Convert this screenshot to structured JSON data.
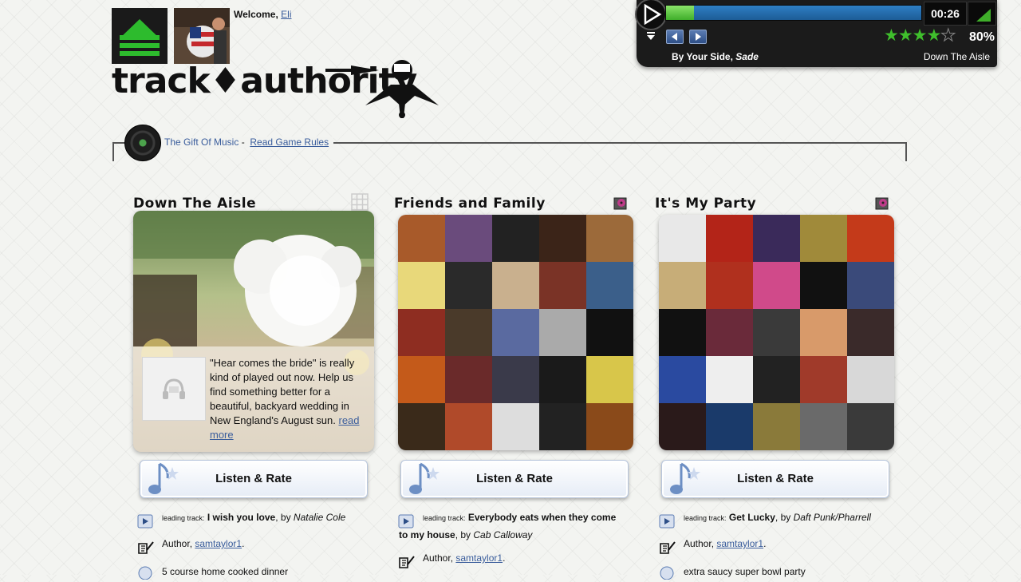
{
  "header": {
    "welcome_label": "Welcome,",
    "user_name": "Eli",
    "brand_logo_text": "track♦authority"
  },
  "player": {
    "time": "00:26",
    "progress_fraction": 0.11,
    "rating_stars": 4,
    "rating_max": 5,
    "rating_pct": "80%",
    "track_title": "By Your Side,",
    "track_artist": "Sade",
    "playlist_name": "Down The Aisle"
  },
  "game": {
    "title": "The Gift Of Music",
    "separator": "-",
    "rules_link": "Read Game Rules"
  },
  "cards": [
    {
      "title": "Down The Aisle",
      "description": "\"Hear comes the bride\" is really kind of played out now. Help us find something better for a beautiful, backyard wedding in New England's August sun.",
      "read_more": "read more",
      "listen_label": "Listen & Rate",
      "leading_label": "leading track:",
      "leading_track": "I wish you love",
      "by": ", by",
      "leading_artist": "Natalie Cole",
      "author_label": "Author,",
      "author": "samtaylor1",
      "dot": ".",
      "extra": "5 course home cooked dinner"
    },
    {
      "title": "Friends and Family",
      "listen_label": "Listen & Rate",
      "leading_label": "leading track:",
      "leading_track": "Everybody eats when they come to my house",
      "by": ", by",
      "leading_artist": "Cab Calloway",
      "author_label": "Author,",
      "author": "samtaylor1",
      "dot": ".",
      "album_grid_colors": [
        "#a85a2a",
        "#6a4b7c",
        "#222",
        "#3b2418",
        "#9c6a3a",
        "#e8d87a",
        "#2a2a2a",
        "#c9b08e",
        "#7a3326",
        "#3b5f8a",
        "#8e2d21",
        "#4a3a2a",
        "#5a6aa0",
        "#aaa",
        "#111",
        "#c45a1a",
        "#6a2a2a",
        "#3a3a4a",
        "#1a1a1a",
        "#d8c64a",
        "#3a2a1a",
        "#b04a2a",
        "#ddd",
        "#222",
        "#8a4a1a"
      ]
    },
    {
      "title": "It's My Party",
      "listen_label": "Listen & Rate",
      "leading_label": "leading track:",
      "leading_track": "Get Lucky",
      "by": ", by",
      "leading_artist": "Daft Punk/Pharrell",
      "author_label": "Author,",
      "author": "samtaylor1",
      "dot": ".",
      "extra": "extra saucy super bowl party",
      "album_grid_colors": [
        "#e8e8e8",
        "#b32418",
        "#3a2a5a",
        "#a08a3a",
        "#c43a1a",
        "#c7ad78",
        "#b0301e",
        "#d04a8a",
        "#111",
        "#3a4a7a",
        "#111",
        "#6a2a3a",
        "#3a3a3a",
        "#d89a6a",
        "#3a2a2a",
        "#2a4aa0",
        "#eee",
        "#222",
        "#a03a2a",
        "#d8d8d8",
        "#2a1a1a",
        "#1a3a6a",
        "#8a7a3a",
        "#6a6a6a",
        "#3a3a3a"
      ]
    }
  ],
  "colors": {
    "accent_link": "#3a5d9c",
    "player_bg": "#1b1b1b",
    "star_green": "#3fbf2c"
  }
}
